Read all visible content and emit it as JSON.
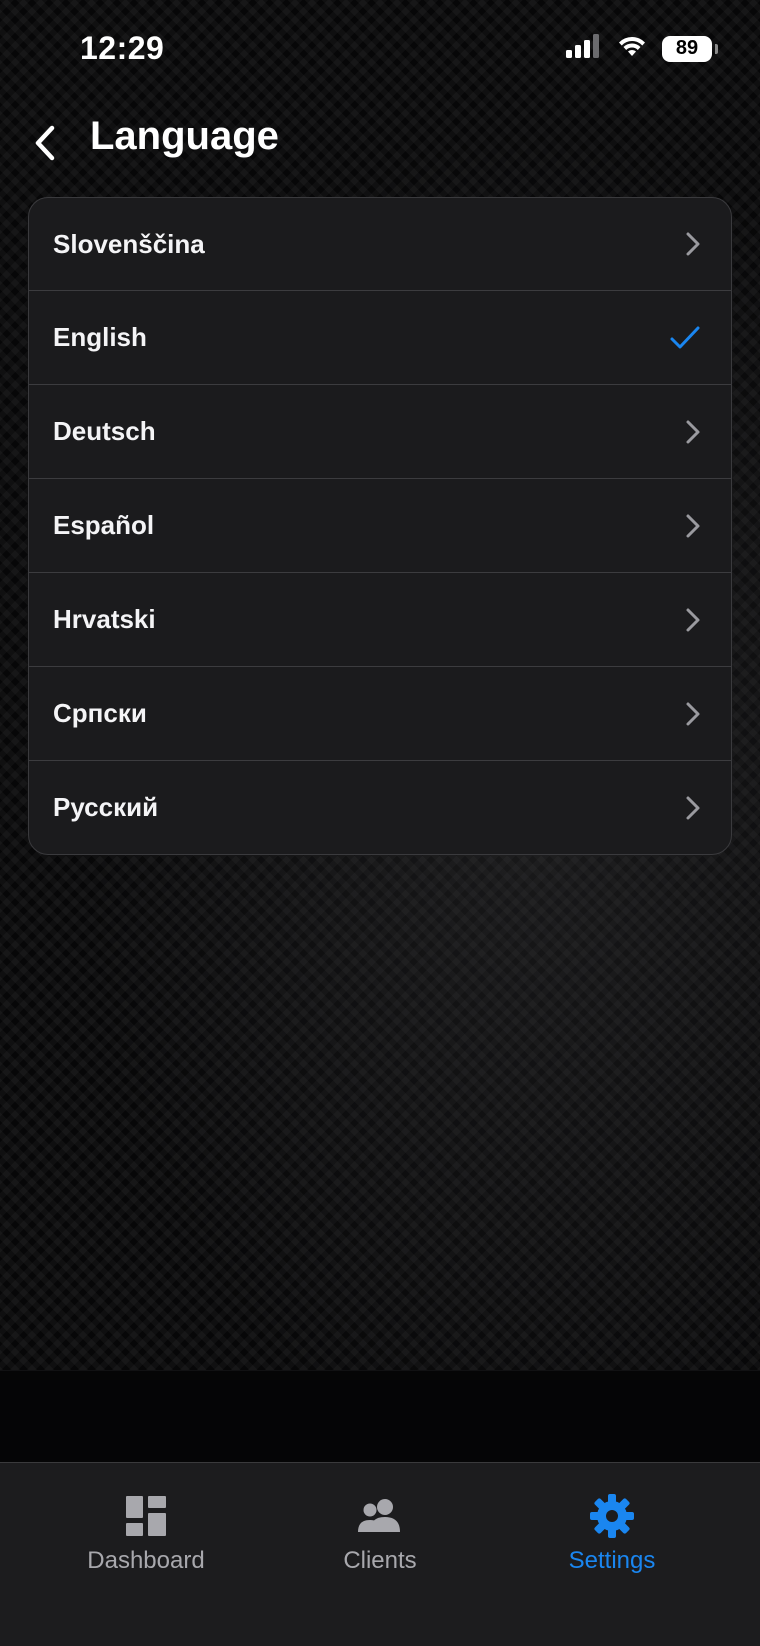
{
  "status_bar": {
    "time": "12:29",
    "battery": "89"
  },
  "header": {
    "title": "Language"
  },
  "languages": [
    {
      "label": "Slovenščina",
      "selected": false
    },
    {
      "label": "English",
      "selected": true
    },
    {
      "label": "Deutsch",
      "selected": false
    },
    {
      "label": "Español",
      "selected": false
    },
    {
      "label": "Hrvatski",
      "selected": false
    },
    {
      "label": "Српски",
      "selected": false
    },
    {
      "label": "Русский",
      "selected": false
    }
  ],
  "tabs": [
    {
      "label": "Dashboard",
      "icon": "dashboard-icon",
      "active": false
    },
    {
      "label": "Clients",
      "icon": "clients-icon",
      "active": false
    },
    {
      "label": "Settings",
      "icon": "settings-gear-icon",
      "active": true
    }
  ],
  "colors": {
    "accent": "#1a86f0",
    "inactive": "#a8a8ad",
    "card": "#1b1b1d"
  }
}
